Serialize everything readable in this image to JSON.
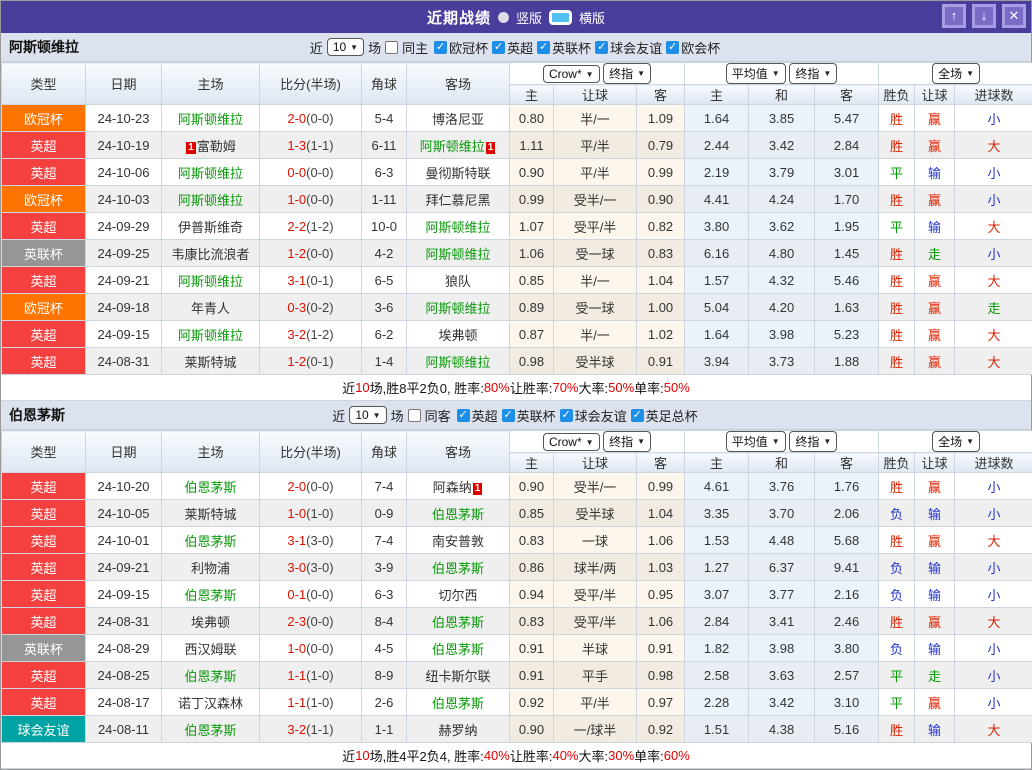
{
  "title_bar": {
    "title": "近期战绩",
    "radio_vertical": "竖版",
    "radio_horizontal": "横版"
  },
  "window_icons": {
    "up_icon": "↑",
    "down_icon": "↓",
    "close_icon": "✕"
  },
  "colors": {
    "accent_purple": "#4a3e9c",
    "score_red": "#dd1100",
    "team_green": "#0a9a0a"
  },
  "league_colors": {
    "欧冠杯": "#ff7300",
    "英超": "#f54040",
    "英联杯": "#969696",
    "球会友谊": "#00a3a3"
  },
  "result_colors": {
    "胜": "#dd2200",
    "赢": "#dd2200",
    "大": "#dd2200",
    "负": "#2233cc",
    "输": "#2233cc",
    "小": "#2233cc",
    "平": "#009900",
    "走": "#009900"
  },
  "table_header": {
    "cols": [
      "类型",
      "日期",
      "主场",
      "比分(半场)",
      "角球",
      "客场"
    ],
    "sub": [
      "主",
      "让球",
      "客",
      "主",
      "和",
      "客",
      "胜负",
      "让球",
      "进球数"
    ],
    "selects": {
      "crow": "Crow*",
      "final1": "终指",
      "avg": "平均值",
      "final2": "终指",
      "full": "全场"
    }
  },
  "sections": [
    {
      "team": "阿斯顿维拉",
      "filter": {
        "near": "近",
        "count": "10",
        "unit": "场",
        "same": "同主",
        "same_checked": false,
        "leagues": [
          "欧冠杯",
          "英超",
          "英联杯",
          "球会友谊",
          "欧会杯"
        ]
      },
      "rows": [
        {
          "lg": "欧冠杯",
          "dt": "24-10-23",
          "h": {
            "n": "阿斯顿维拉",
            "hl": true
          },
          "sc": "2-0",
          "hf": "(0-0)",
          "cn": "5-4",
          "a": {
            "n": "博洛尼亚"
          },
          "o": [
            "0.80",
            "半/一",
            "1.09"
          ],
          "v": [
            "1.64",
            "3.85",
            "5.47"
          ],
          "r": [
            "胜",
            "赢",
            "小"
          ]
        },
        {
          "lg": "英超",
          "dt": "24-10-19",
          "h": {
            "n": "富勒姆",
            "b1": "1"
          },
          "sc": "1-3",
          "hf": "(1-1)",
          "cn": "6-11",
          "a": {
            "n": "阿斯顿维拉",
            "hl": true,
            "b2": "1"
          },
          "o": [
            "1.11",
            "平/半",
            "0.79"
          ],
          "v": [
            "2.44",
            "3.42",
            "2.84"
          ],
          "r": [
            "胜",
            "赢",
            "大"
          ]
        },
        {
          "lg": "英超",
          "dt": "24-10-06",
          "h": {
            "n": "阿斯顿维拉",
            "hl": true
          },
          "sc": "0-0",
          "hf": "(0-0)",
          "cn": "6-3",
          "a": {
            "n": "曼彻斯特联"
          },
          "o": [
            "0.90",
            "平/半",
            "0.99"
          ],
          "v": [
            "2.19",
            "3.79",
            "3.01"
          ],
          "r": [
            "平",
            "输",
            "小"
          ]
        },
        {
          "lg": "欧冠杯",
          "dt": "24-10-03",
          "h": {
            "n": "阿斯顿维拉",
            "hl": true
          },
          "sc": "1-0",
          "hf": "(0-0)",
          "cn": "1-11",
          "a": {
            "n": "拜仁慕尼黑"
          },
          "o": [
            "0.99",
            "受半/一",
            "0.90"
          ],
          "v": [
            "4.41",
            "4.24",
            "1.70"
          ],
          "r": [
            "胜",
            "赢",
            "小"
          ]
        },
        {
          "lg": "英超",
          "dt": "24-09-29",
          "h": {
            "n": "伊普斯维奇"
          },
          "sc": "2-2",
          "hf": "(1-2)",
          "cn": "10-0",
          "a": {
            "n": "阿斯顿维拉",
            "hl": true
          },
          "o": [
            "1.07",
            "受平/半",
            "0.82"
          ],
          "v": [
            "3.80",
            "3.62",
            "1.95"
          ],
          "r": [
            "平",
            "输",
            "大"
          ]
        },
        {
          "lg": "英联杯",
          "dt": "24-09-25",
          "h": {
            "n": "韦康比流浪者"
          },
          "sc": "1-2",
          "hf": "(0-0)",
          "cn": "4-2",
          "a": {
            "n": "阿斯顿维拉",
            "hl": true
          },
          "o": [
            "1.06",
            "受一球",
            "0.83"
          ],
          "v": [
            "6.16",
            "4.80",
            "1.45"
          ],
          "r": [
            "胜",
            "走",
            "小"
          ]
        },
        {
          "lg": "英超",
          "dt": "24-09-21",
          "h": {
            "n": "阿斯顿维拉",
            "hl": true
          },
          "sc": "3-1",
          "hf": "(0-1)",
          "cn": "6-5",
          "a": {
            "n": "狼队"
          },
          "o": [
            "0.85",
            "半/一",
            "1.04"
          ],
          "v": [
            "1.57",
            "4.32",
            "5.46"
          ],
          "r": [
            "胜",
            "赢",
            "大"
          ]
        },
        {
          "lg": "欧冠杯",
          "dt": "24-09-18",
          "h": {
            "n": "年青人"
          },
          "sc": "0-3",
          "hf": "(0-2)",
          "cn": "3-6",
          "a": {
            "n": "阿斯顿维拉",
            "hl": true
          },
          "o": [
            "0.89",
            "受一球",
            "1.00"
          ],
          "v": [
            "5.04",
            "4.20",
            "1.63"
          ],
          "r": [
            "胜",
            "赢",
            "走"
          ]
        },
        {
          "lg": "英超",
          "dt": "24-09-15",
          "h": {
            "n": "阿斯顿维拉",
            "hl": true
          },
          "sc": "3-2",
          "hf": "(1-2)",
          "cn": "6-2",
          "a": {
            "n": "埃弗顿"
          },
          "o": [
            "0.87",
            "半/一",
            "1.02"
          ],
          "v": [
            "1.64",
            "3.98",
            "5.23"
          ],
          "r": [
            "胜",
            "赢",
            "大"
          ]
        },
        {
          "lg": "英超",
          "dt": "24-08-31",
          "h": {
            "n": "莱斯特城"
          },
          "sc": "1-2",
          "hf": "(0-1)",
          "cn": "1-4",
          "a": {
            "n": "阿斯顿维拉",
            "hl": true
          },
          "o": [
            "0.98",
            "受半球",
            "0.91"
          ],
          "v": [
            "3.94",
            "3.73",
            "1.88"
          ],
          "r": [
            "胜",
            "赢",
            "大"
          ]
        }
      ],
      "summary": [
        "近",
        "10",
        "场,胜8平2负0, 胜率:",
        "80%",
        " 让胜率:",
        "70%",
        " 大率:",
        "50%",
        " 单率:",
        "50%"
      ]
    },
    {
      "team": "伯恩茅斯",
      "filter": {
        "near": "近",
        "count": "10",
        "unit": "场",
        "same": "同客",
        "same_checked": false,
        "leagues": [
          "英超",
          "英联杯",
          "球会友谊",
          "英足总杯"
        ]
      },
      "rows": [
        {
          "lg": "英超",
          "dt": "24-10-20",
          "h": {
            "n": "伯恩茅斯",
            "hl": true
          },
          "sc": "2-0",
          "hf": "(0-0)",
          "cn": "7-4",
          "a": {
            "n": "阿森纳",
            "b2": "1"
          },
          "o": [
            "0.90",
            "受半/一",
            "0.99"
          ],
          "v": [
            "4.61",
            "3.76",
            "1.76"
          ],
          "r": [
            "胜",
            "赢",
            "小"
          ]
        },
        {
          "lg": "英超",
          "dt": "24-10-05",
          "h": {
            "n": "莱斯特城"
          },
          "sc": "1-0",
          "hf": "(1-0)",
          "cn": "0-9",
          "a": {
            "n": "伯恩茅斯",
            "hl": true
          },
          "o": [
            "0.85",
            "受半球",
            "1.04"
          ],
          "v": [
            "3.35",
            "3.70",
            "2.06"
          ],
          "r": [
            "负",
            "输",
            "小"
          ]
        },
        {
          "lg": "英超",
          "dt": "24-10-01",
          "h": {
            "n": "伯恩茅斯",
            "hl": true
          },
          "sc": "3-1",
          "hf": "(3-0)",
          "cn": "7-4",
          "a": {
            "n": "南安普敦"
          },
          "o": [
            "0.83",
            "一球",
            "1.06"
          ],
          "v": [
            "1.53",
            "4.48",
            "5.68"
          ],
          "r": [
            "胜",
            "赢",
            "大"
          ]
        },
        {
          "lg": "英超",
          "dt": "24-09-21",
          "h": {
            "n": "利物浦"
          },
          "sc": "3-0",
          "hf": "(3-0)",
          "cn": "3-9",
          "a": {
            "n": "伯恩茅斯",
            "hl": true
          },
          "o": [
            "0.86",
            "球半/两",
            "1.03"
          ],
          "v": [
            "1.27",
            "6.37",
            "9.41"
          ],
          "r": [
            "负",
            "输",
            "小"
          ]
        },
        {
          "lg": "英超",
          "dt": "24-09-15",
          "h": {
            "n": "伯恩茅斯",
            "hl": true
          },
          "sc": "0-1",
          "hf": "(0-0)",
          "cn": "6-3",
          "a": {
            "n": "切尔西"
          },
          "o": [
            "0.94",
            "受平/半",
            "0.95"
          ],
          "v": [
            "3.07",
            "3.77",
            "2.16"
          ],
          "r": [
            "负",
            "输",
            "小"
          ]
        },
        {
          "lg": "英超",
          "dt": "24-08-31",
          "h": {
            "n": "埃弗顿"
          },
          "sc": "2-3",
          "hf": "(0-0)",
          "cn": "8-4",
          "a": {
            "n": "伯恩茅斯",
            "hl": true
          },
          "o": [
            "0.83",
            "受平/半",
            "1.06"
          ],
          "v": [
            "2.84",
            "3.41",
            "2.46"
          ],
          "r": [
            "胜",
            "赢",
            "大"
          ]
        },
        {
          "lg": "英联杯",
          "dt": "24-08-29",
          "h": {
            "n": "西汉姆联"
          },
          "sc": "1-0",
          "hf": "(0-0)",
          "cn": "4-5",
          "a": {
            "n": "伯恩茅斯",
            "hl": true
          },
          "o": [
            "0.91",
            "半球",
            "0.91"
          ],
          "v": [
            "1.82",
            "3.98",
            "3.80"
          ],
          "r": [
            "负",
            "输",
            "小"
          ]
        },
        {
          "lg": "英超",
          "dt": "24-08-25",
          "h": {
            "n": "伯恩茅斯",
            "hl": true
          },
          "sc": "1-1",
          "hf": "(1-0)",
          "cn": "8-9",
          "a": {
            "n": "纽卡斯尔联"
          },
          "o": [
            "0.91",
            "平手",
            "0.98"
          ],
          "v": [
            "2.58",
            "3.63",
            "2.57"
          ],
          "r": [
            "平",
            "走",
            "小"
          ]
        },
        {
          "lg": "英超",
          "dt": "24-08-17",
          "h": {
            "n": "诺丁汉森林"
          },
          "sc": "1-1",
          "hf": "(1-0)",
          "cn": "2-6",
          "a": {
            "n": "伯恩茅斯",
            "hl": true
          },
          "o": [
            "0.92",
            "平/半",
            "0.97"
          ],
          "v": [
            "2.28",
            "3.42",
            "3.10"
          ],
          "r": [
            "平",
            "赢",
            "小"
          ]
        },
        {
          "lg": "球会友谊",
          "dt": "24-08-11",
          "h": {
            "n": "伯恩茅斯",
            "hl": true
          },
          "sc": "3-2",
          "hf": "(1-1)",
          "cn": "1-1",
          "a": {
            "n": "赫罗纳"
          },
          "o": [
            "0.90",
            "一/球半",
            "0.92"
          ],
          "v": [
            "1.51",
            "4.38",
            "5.16"
          ],
          "r": [
            "胜",
            "输",
            "大"
          ]
        }
      ],
      "summary": [
        "近",
        "10",
        "场,胜4平2负4, 胜率:",
        "40%",
        " 让胜率:",
        "40%",
        " 大率:",
        "30%",
        " 单率:",
        "60%"
      ]
    }
  ]
}
